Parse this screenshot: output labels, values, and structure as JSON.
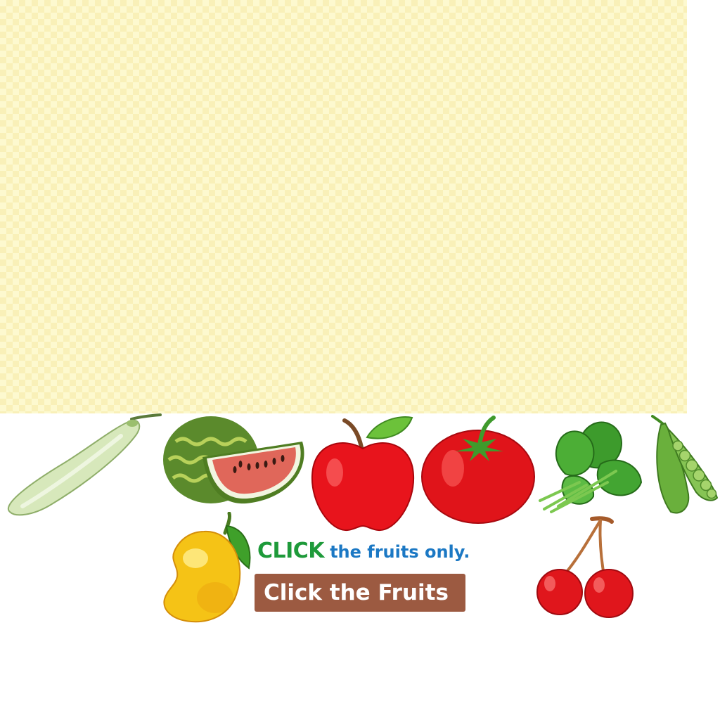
{
  "instruction": {
    "highlight": "CLICK",
    "rest": "the fruits only."
  },
  "button": {
    "label": "Click the Fruits"
  },
  "colors": {
    "playfield_bg": "#fdf9cf",
    "instruction_highlight": "#1e9a3a",
    "instruction_text": "#1b78c4",
    "button_bg": "#9c5a41",
    "button_text": "#ffffff"
  },
  "items": [
    {
      "icon": "bottle-gourd-icon",
      "kind": "vegetable"
    },
    {
      "icon": "watermelon-icon",
      "kind": "fruit"
    },
    {
      "icon": "apple-icon",
      "kind": "fruit"
    },
    {
      "icon": "tomato-icon",
      "kind": "vegetable"
    },
    {
      "icon": "spinach-icon",
      "kind": "vegetable"
    },
    {
      "icon": "peas-icon",
      "kind": "vegetable"
    },
    {
      "icon": "mango-icon",
      "kind": "fruit"
    },
    {
      "icon": "cherries-icon",
      "kind": "fruit"
    }
  ]
}
